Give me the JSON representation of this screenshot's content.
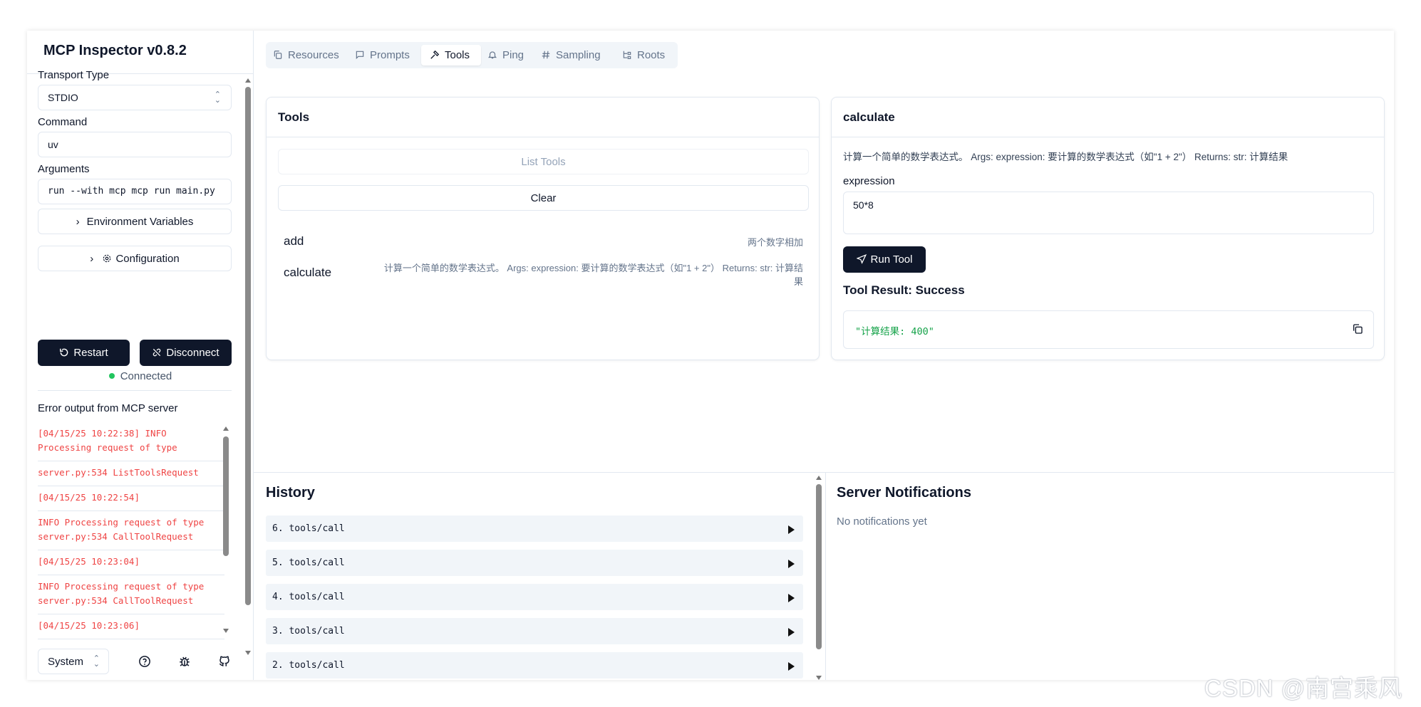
{
  "app": {
    "title": "MCP Inspector v0.8.2"
  },
  "sidebar": {
    "transport_label": "Transport Type",
    "transport_value": "STDIO",
    "command_label": "Command",
    "command_value": "uv",
    "arguments_label": "Arguments",
    "arguments_value": "run --with mcp mcp run main.py",
    "env_button": "Environment Variables",
    "config_button": "Configuration",
    "restart_button": "Restart",
    "disconnect_button": "Disconnect",
    "status": "Connected",
    "status_color": "#22c55e",
    "error_title": "Error output from MCP server",
    "errors": [
      "[04/15/25 10:22:38] INFO Processing request of type",
      "server.py:534 ListToolsRequest",
      "[04/15/25 10:22:54]",
      "INFO Processing request of type server.py:534 CallToolRequest",
      "[04/15/25 10:23:04]",
      "INFO Processing request of type server.py:534 CallToolRequest",
      "[04/15/25 10:23:06]"
    ],
    "theme_value": "System",
    "footer_icons": [
      "help-icon",
      "bug-icon",
      "github-icon"
    ]
  },
  "tabs": [
    {
      "label": "Resources",
      "icon": "resources-icon"
    },
    {
      "label": "Prompts",
      "icon": "prompts-icon"
    },
    {
      "label": "Tools",
      "icon": "hammer-icon"
    },
    {
      "label": "Ping",
      "icon": "bell-icon"
    },
    {
      "label": "Sampling",
      "icon": "hash-icon"
    },
    {
      "label": "Roots",
      "icon": "roots-icon"
    }
  ],
  "tools_panel": {
    "title": "Tools",
    "list_button": "List Tools",
    "clear_button": "Clear",
    "tools": [
      {
        "name": "add",
        "description": "两个数字相加"
      },
      {
        "name": "calculate",
        "description_line1": "计算一个简单的数学表达式。 Args: expression: 要计算的数学表达式（如\"1 + 2\"） Returns: str: 计算结",
        "description_line2": "果"
      }
    ]
  },
  "tool_detail": {
    "title": "calculate",
    "description": "计算一个简单的数学表达式。 Args: expression: 要计算的数学表达式（如\"1 + 2\"） Returns: str: 计算结果",
    "param_label": "expression",
    "param_value": "50*8",
    "run_button": "Run Tool",
    "result_title": "Tool Result: Success",
    "result_value": "\"计算结果: 400\"",
    "result_color": "#16a34a"
  },
  "history": {
    "title": "History",
    "items": [
      "6. tools/call",
      "5. tools/call",
      "4. tools/call",
      "3. tools/call",
      "2. tools/call"
    ]
  },
  "notifications": {
    "title": "Server Notifications",
    "empty": "No notifications yet"
  },
  "watermark": "CSDN @南宫乘风"
}
